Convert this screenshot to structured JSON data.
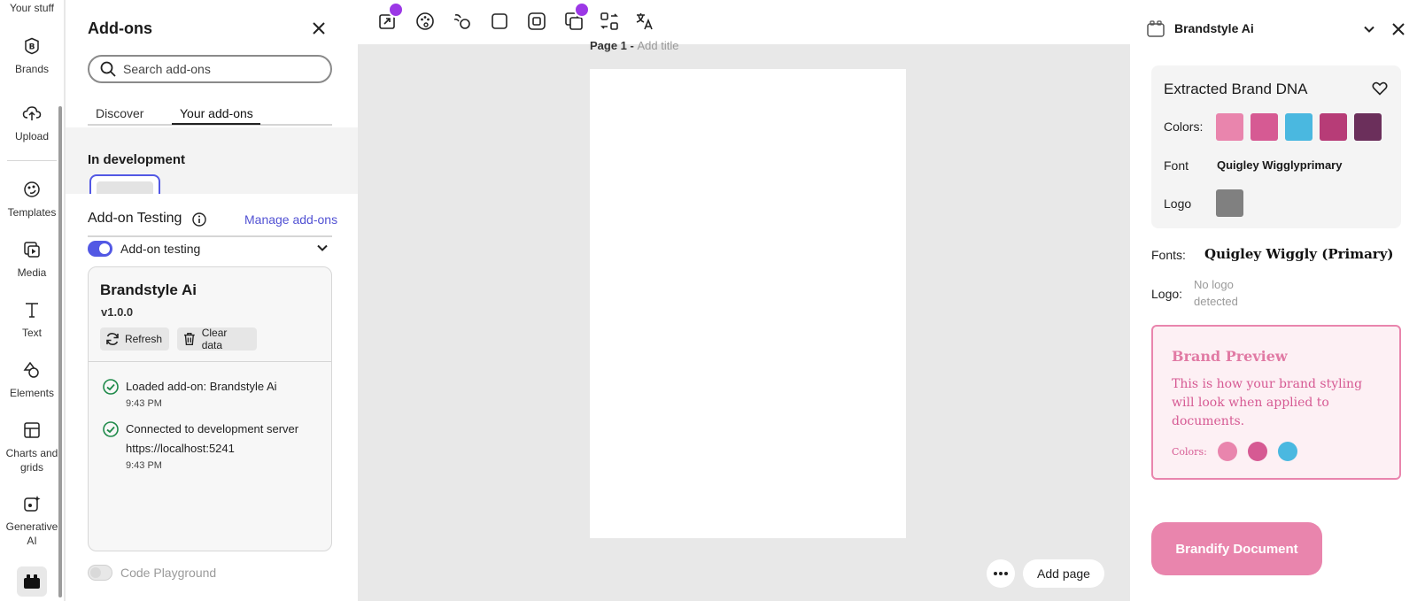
{
  "rail": {
    "top_label": "Your stuff",
    "items": [
      {
        "label": "Brands"
      },
      {
        "label": "Upload"
      },
      {
        "label": "Templates"
      },
      {
        "label": "Media"
      },
      {
        "label": "Text"
      },
      {
        "label": "Elements"
      },
      {
        "label": "Charts and grids"
      },
      {
        "label": "Generative AI"
      }
    ]
  },
  "addons": {
    "title": "Add-ons",
    "search_placeholder": "Search add-ons",
    "tabs": [
      {
        "label": "Discover"
      },
      {
        "label": "Your add-ons",
        "active": true
      }
    ],
    "dev_title": "In development",
    "testing": {
      "title": "Add-on Testing",
      "manage_link": "Manage add-ons",
      "toggle_label": "Add-on testing",
      "toggle_on": true,
      "card": {
        "name": "Brandstyle Ai",
        "version": "v1.0.0",
        "refresh_label": "Refresh",
        "clear_label": "Clear data",
        "logs": [
          {
            "message": "Loaded add-on: Brandstyle Ai",
            "time": "9:43 PM"
          },
          {
            "message": "Connected to development server https://localhost:5241",
            "time": "9:43 PM"
          }
        ]
      },
      "playground_label": "Code Playground",
      "playground_on": false
    }
  },
  "canvas": {
    "page_label": "Page 1 - ",
    "page_title_placeholder": "Add title",
    "add_page_label": "Add page"
  },
  "brand_panel": {
    "title": "Brandstyle Ai",
    "dna": {
      "title": "Extracted Brand DNA",
      "colors_label": "Colors:",
      "colors": [
        "#e985ad",
        "#d65a93",
        "#4ab8e0",
        "#b73c77",
        "#6b2f5b"
      ],
      "font_label": "Font",
      "font_value": "Quigley Wigglyprimary",
      "logo_label": "Logo"
    },
    "fonts_label": "Fonts:",
    "fonts_value": "Quigley Wiggly (Primary)",
    "logo_label": "Logo:",
    "logo_value": "No logo detected",
    "preview": {
      "title": "Brand Preview",
      "body": "This is how your brand styling will look when applied to documents.",
      "colors_label": "Colors:",
      "colors": [
        "#e985ad",
        "#d65a93",
        "#4ab8e0"
      ]
    },
    "cta_label": "Brandify Document"
  },
  "colors": {
    "accent": "#5258e4",
    "brand_pink": "#e985ad",
    "crown_purple": "#9c38e6",
    "success_green": "#1f8a4a"
  }
}
